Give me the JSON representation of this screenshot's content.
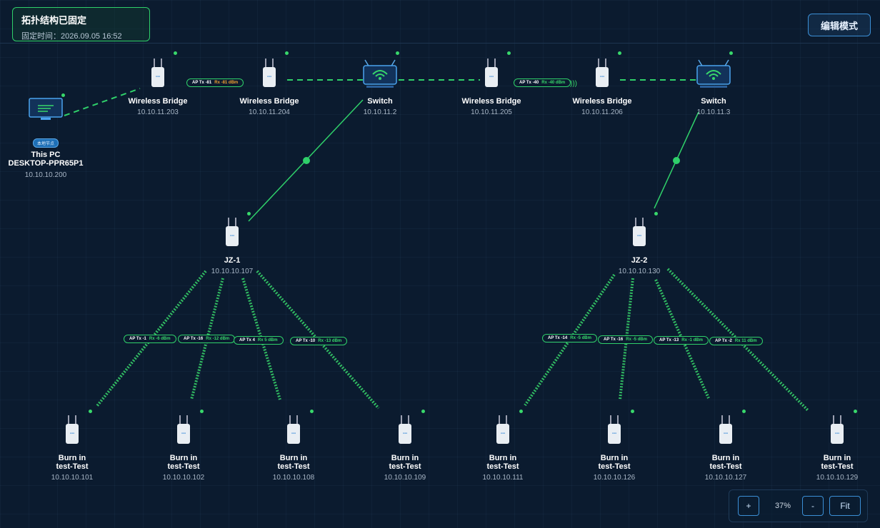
{
  "header": {
    "status_title": "拓扑结构已固定",
    "status_time": "固定时间：2026.09.05 16:52",
    "edit_label": "编辑模式"
  },
  "nodes": {
    "pc": {
      "badge": "本地节点",
      "name": "This PC",
      "host": "DESKTOP-PPR65P1",
      "ip": "10.10.10.200"
    },
    "wb203": {
      "name": "Wireless Bridge",
      "ip": "10.10.11.203"
    },
    "wb204": {
      "name": "Wireless Bridge",
      "ip": "10.10.11.204"
    },
    "sw2": {
      "name": "Switch",
      "ip": "10.10.11.2"
    },
    "wb205": {
      "name": "Wireless Bridge",
      "ip": "10.10.11.205"
    },
    "wb206": {
      "name": "Wireless Bridge",
      "ip": "10.10.11.206"
    },
    "sw3": {
      "name": "Switch",
      "ip": "10.10.11.3"
    },
    "jz1": {
      "name": "JZ-1",
      "ip": "10.10.10.107"
    },
    "jz2": {
      "name": "JZ-2",
      "ip": "10.10.10.130"
    },
    "b101": {
      "name": "Burn in",
      "name2": "test-Test",
      "ip": "10.10.10.101"
    },
    "b102": {
      "name": "Burn in",
      "name2": "test-Test",
      "ip": "10.10.10.102"
    },
    "b108": {
      "name": "Burn in",
      "name2": "test-Test",
      "ip": "10.10.10.108"
    },
    "b109": {
      "name": "Burn in",
      "name2": "test-Test",
      "ip": "10.10.10.109"
    },
    "b111": {
      "name": "Burn in",
      "name2": "test-Test",
      "ip": "10.10.10.111"
    },
    "b126": {
      "name": "Burn in",
      "name2": "test-Test",
      "ip": "10.10.10.126"
    },
    "b127": {
      "name": "Burn in",
      "name2": "test-Test",
      "ip": "10.10.10.127"
    },
    "b129": {
      "name": "Burn in",
      "name2": "test-Test",
      "ip": "10.10.10.129"
    }
  },
  "links": {
    "l1": {
      "tx": "AP Tx -81",
      "rx": "Rx -81 dBm",
      "rx_color": "#f0a030"
    },
    "l2": {
      "tx": "AP Tx -40",
      "rx": "Rx -40 dBm",
      "rx_color": "#38d86b"
    },
    "j1a": {
      "tx": "AP Tx -1",
      "rx": "Rx -6 dBm"
    },
    "j1b": {
      "tx": "AP Tx -16",
      "rx": "Rx -12 dBm"
    },
    "j1c": {
      "tx": "AP Tx 4",
      "rx": "Rx 5 dBm"
    },
    "j1d": {
      "tx": "AP Tx -10",
      "rx": "Rx -13 dBm"
    },
    "j2a": {
      "tx": "AP Tx -14",
      "rx": "Rx -5 dBm"
    },
    "j2b": {
      "tx": "AP Tx -16",
      "rx": "Rx -5 dBm"
    },
    "j2c": {
      "tx": "AP Tx -13",
      "rx": "Rx -1 dBm"
    },
    "j2d": {
      "tx": "AP Tx -2",
      "rx": "Rx 11 dBm"
    }
  },
  "zoom": {
    "plus": "+",
    "level": "37%",
    "minus": "-",
    "fit": "Fit"
  },
  "colors": {
    "accent_green": "#38d86b",
    "accent_blue": "#3b8fd6",
    "warning_orange": "#f0a030"
  },
  "icons": {
    "pc": "monitor-icon",
    "bridge": "wireless-bridge-icon",
    "switch": "wifi-router-icon"
  }
}
